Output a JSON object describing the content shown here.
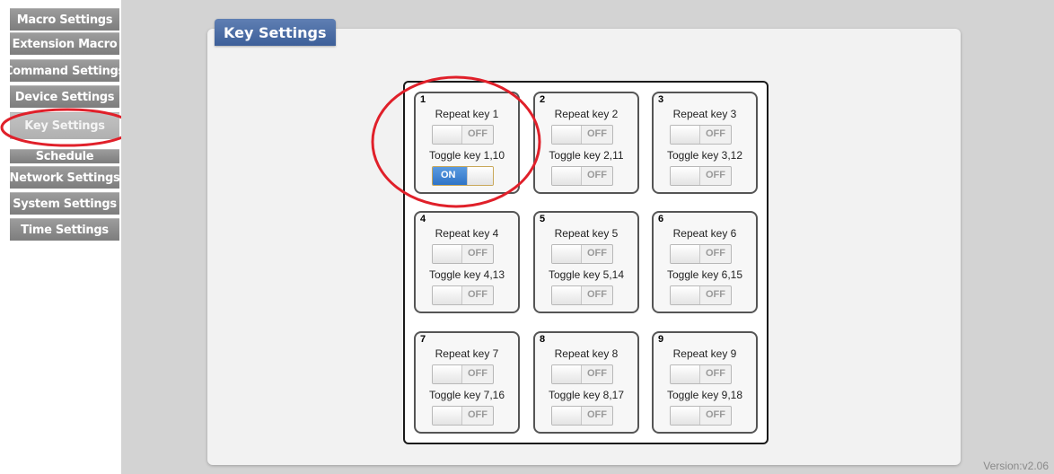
{
  "sidebar": {
    "items": [
      {
        "label": "Macro Settings",
        "active": false
      },
      {
        "label": "Extension Macro",
        "active": false
      },
      {
        "label": "Command Settings",
        "active": false
      },
      {
        "label": "Device Settings",
        "active": false
      },
      {
        "label": "Key Settings",
        "active": true
      },
      {
        "label": "Schedule",
        "active": false
      },
      {
        "label": "Network Settings",
        "active": false
      },
      {
        "label": "System Settings",
        "active": false
      },
      {
        "label": "Time Settings",
        "active": false
      }
    ]
  },
  "panel": {
    "title": "Key Settings"
  },
  "keys": [
    {
      "num": "1",
      "repeat_label": "Repeat key 1",
      "repeat": "OFF",
      "toggle_label": "Toggle key 1,10",
      "toggle": "ON"
    },
    {
      "num": "2",
      "repeat_label": "Repeat key 2",
      "repeat": "OFF",
      "toggle_label": "Toggle key 2,11",
      "toggle": "OFF"
    },
    {
      "num": "3",
      "repeat_label": "Repeat key 3",
      "repeat": "OFF",
      "toggle_label": "Toggle key 3,12",
      "toggle": "OFF"
    },
    {
      "num": "4",
      "repeat_label": "Repeat key 4",
      "repeat": "OFF",
      "toggle_label": "Toggle key 4,13",
      "toggle": "OFF"
    },
    {
      "num": "5",
      "repeat_label": "Repeat key 5",
      "repeat": "OFF",
      "toggle_label": "Toggle key 5,14",
      "toggle": "OFF"
    },
    {
      "num": "6",
      "repeat_label": "Repeat key 6",
      "repeat": "OFF",
      "toggle_label": "Toggle key 6,15",
      "toggle": "OFF"
    },
    {
      "num": "7",
      "repeat_label": "Repeat key 7",
      "repeat": "OFF",
      "toggle_label": "Toggle key 7,16",
      "toggle": "OFF"
    },
    {
      "num": "8",
      "repeat_label": "Repeat key 8",
      "repeat": "OFF",
      "toggle_label": "Toggle key 8,17",
      "toggle": "OFF"
    },
    {
      "num": "9",
      "repeat_label": "Repeat key 9",
      "repeat": "OFF",
      "toggle_label": "Toggle key 9,18",
      "toggle": "OFF"
    }
  ],
  "version": "Version:v2.06",
  "colors": {
    "annotation": "#e0202a",
    "title_bar": "#4a6ba6",
    "toggle_on": "#3b82d0"
  }
}
